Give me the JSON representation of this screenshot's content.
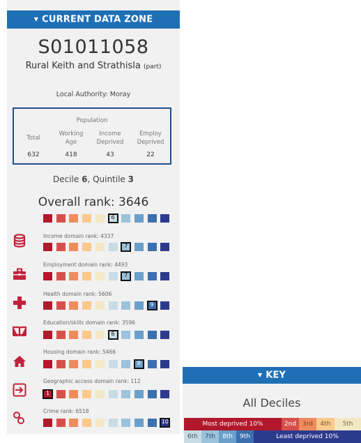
{
  "panel": {
    "header": "CURRENT DATA ZONE",
    "zone_code": "S01011058",
    "zone_name": "Rural Keith and Strathisla",
    "zone_suffix": "(part)",
    "local_authority": "Local Authority: Moray",
    "population": {
      "title": "Population",
      "columns": [
        {
          "label1": "Total",
          "label2": "",
          "value": "632"
        },
        {
          "label1": "Working",
          "label2": "Age",
          "value": "418"
        },
        {
          "label1": "Income",
          "label2": "Deprived",
          "value": "43"
        },
        {
          "label1": "Employ",
          "label2": "Deprived",
          "value": "22"
        }
      ]
    },
    "decile_prefix": "Decile ",
    "decile_value": "6",
    "quintile_prefix": ", Quintile ",
    "quintile_value": "3",
    "overall_rank": "Overall rank: 3646",
    "overall_decile": 6
  },
  "domains": [
    {
      "label": "Income domain rank: 4337",
      "decile": 7,
      "icon": "database-icon"
    },
    {
      "label": "Employment domain rank: 4493",
      "decile": 7,
      "icon": "briefcase-icon"
    },
    {
      "label": "Health domain rank: 5606",
      "decile": 9,
      "icon": "health-cross-icon"
    },
    {
      "label": "Education/skills domain rank: 3596",
      "decile": 6,
      "icon": "book-icon"
    },
    {
      "label": "Housing domain rank: 5466",
      "decile": 8,
      "icon": "house-icon"
    },
    {
      "label": "Geographic access domain rank: 112",
      "decile": 1,
      "icon": "exit-arrow-icon"
    },
    {
      "label": "Crime rank: 6518",
      "decile": 10,
      "icon": "handcuffs-icon"
    }
  ],
  "decile_colors": [
    "#b2182b",
    "#d6504b",
    "#ee8c5e",
    "#fbc98c",
    "#f3e8c6",
    "#c8dce6",
    "#9cc3dc",
    "#6a9fcb",
    "#3c6fb0",
    "#2c3a8e"
  ],
  "accent_color": "#1f6fb5",
  "key": {
    "header": "KEY",
    "title": "All Deciles",
    "most_deprived": "Most deprived 10%",
    "least_deprived": "Least deprived 10%",
    "top_labels": [
      "2nd",
      "3rd",
      "4th",
      "5th"
    ],
    "bottom_labels": [
      "6th",
      "7th",
      "8th",
      "9th"
    ]
  }
}
